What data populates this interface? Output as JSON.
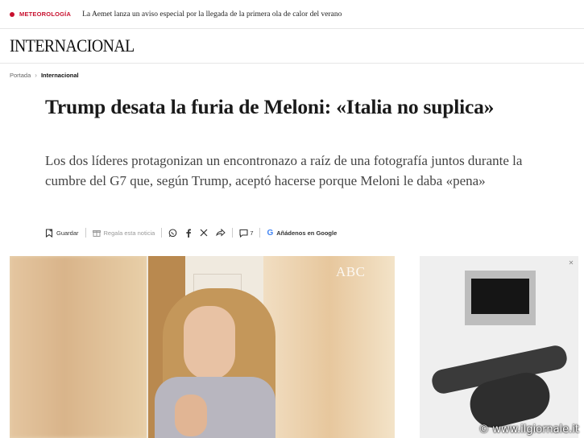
{
  "ticker": {
    "tag": "METEOROLOGÍA",
    "headline": "La Aemet lanza un aviso especial por la llegada de la primera ola de calor del verano"
  },
  "section": {
    "title": "INTERNACIONAL"
  },
  "breadcrumb": {
    "home": "Portada",
    "current": "Internacional"
  },
  "article": {
    "title": "Trump desata la furia de Meloni: «Italia no suplica»",
    "subtitle": "Los dos líderes protagonizan un encontronazo a raíz de una fotografía juntos durante la cumbre del G7 que, según Trump, aceptó hacerse porque Meloni le daba «pena»"
  },
  "actions": {
    "save_label": "Guardar",
    "gift_label": "Regala esta noticia",
    "comments_count": "7",
    "google_label": "Añádenos en Google"
  },
  "media": {
    "watermark": "ABC"
  },
  "footer": {
    "watermark": "© www.ilgiornale.it"
  },
  "colors": {
    "accent": "#c8102e",
    "google_blue": "#4285f4"
  },
  "icons": [
    "bookmark-icon",
    "gift-icon",
    "whatsapp-icon",
    "facebook-icon",
    "x-icon",
    "share-icon",
    "comment-icon",
    "google-icon"
  ]
}
